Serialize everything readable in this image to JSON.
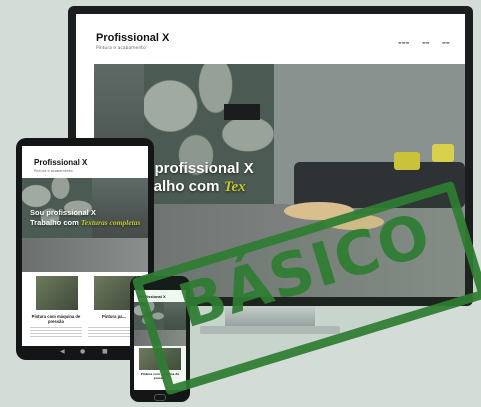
{
  "desktop": {
    "site_title": "Profissional X",
    "site_subtitle": "Pintura e acabamento",
    "nav": [
      "",
      ""
    ],
    "hero_line1": "Sou profissional X",
    "hero_line2_prefix": "Trabalho com",
    "hero_line2_accent": "Tex"
  },
  "tablet": {
    "site_title": "Profissional X",
    "site_subtitle": "Pintura e acabamento",
    "hero_line1": "Sou profissional X",
    "hero_line2_prefix": "Trabalho com",
    "hero_line2_accent": "Texturas completas",
    "cards": [
      {
        "label": "Pintura com máquina de pressão"
      },
      {
        "label": "Pintura pa..."
      }
    ]
  },
  "phone": {
    "site_title": "Profissional X",
    "card_label": "Pintura com máquina de pressão"
  },
  "stamp": {
    "text": "BÁSICO",
    "color": "#2e7d32"
  },
  "colors": {
    "accent": "#c5c92e",
    "device": "#141516",
    "background": "#d4dcd8"
  }
}
